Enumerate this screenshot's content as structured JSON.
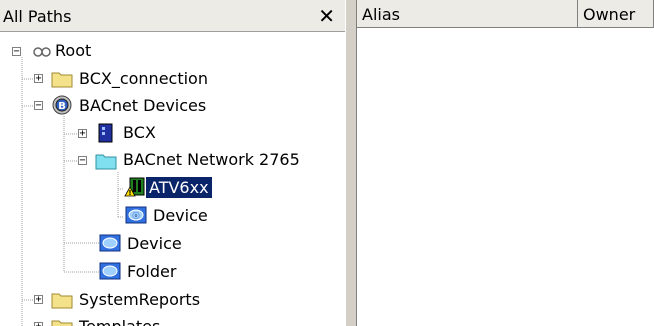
{
  "left_pane": {
    "title": "All Paths",
    "close_glyph": "✕"
  },
  "columns": {
    "alias": "Alias",
    "owner": "Owner"
  },
  "tree": {
    "root": "Root",
    "bcx_connection": "BCX_connection",
    "bacnet_devices": "BACnet Devices",
    "bcx": "BCX",
    "bacnet_network": "BACnet Network 2765",
    "atv6xx": "ATV6xx",
    "device_inner": "Device",
    "device": "Device",
    "folder": "Folder",
    "system_reports": "SystemReports",
    "templates": "Templates"
  },
  "icons": {
    "root": "root-icon",
    "folder": "folder-icon",
    "bacnet": "bacnet-icon",
    "bcx": "bcx-device-icon",
    "network_folder": "network-folder-icon",
    "atv": "drive-warning-icon",
    "device_object": "device-object-icon"
  },
  "colors": {
    "selection": "#0a246a",
    "header_bg": "#ecebe6",
    "splitter": "#d4d0c8"
  }
}
